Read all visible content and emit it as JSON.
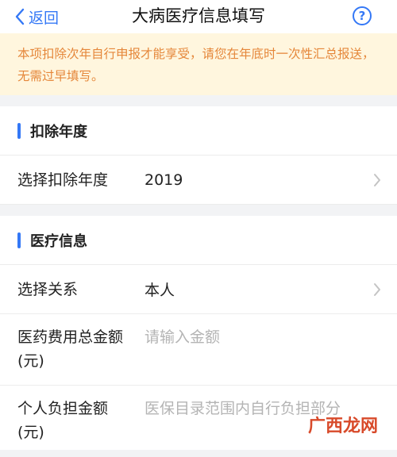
{
  "navbar": {
    "back_label": "返回",
    "title": "大病医疗信息填写",
    "help_icon": "question-circle-icon",
    "accent": "#3478f6"
  },
  "notice": {
    "text": "本项扣除次年自行申报才能享受，请您在年底时一次性汇总报送，无需过早填写。",
    "color": "#e5873a",
    "background": "#fff6de"
  },
  "deduction_year_section": {
    "header": "扣除年度",
    "row": {
      "label": "选择扣除年度",
      "value": "2019"
    }
  },
  "medical_section": {
    "header": "医疗信息",
    "relation_row": {
      "label": "选择关系",
      "value": "本人"
    },
    "total_fee_row": {
      "label": "医药费用总金额(元)",
      "placeholder": "请输入金额"
    },
    "personal_row": {
      "label": "个人负担金额(元)",
      "placeholder": "医保目录范围内自行负担部分"
    }
  },
  "watermark": {
    "text": "广西龙网"
  }
}
